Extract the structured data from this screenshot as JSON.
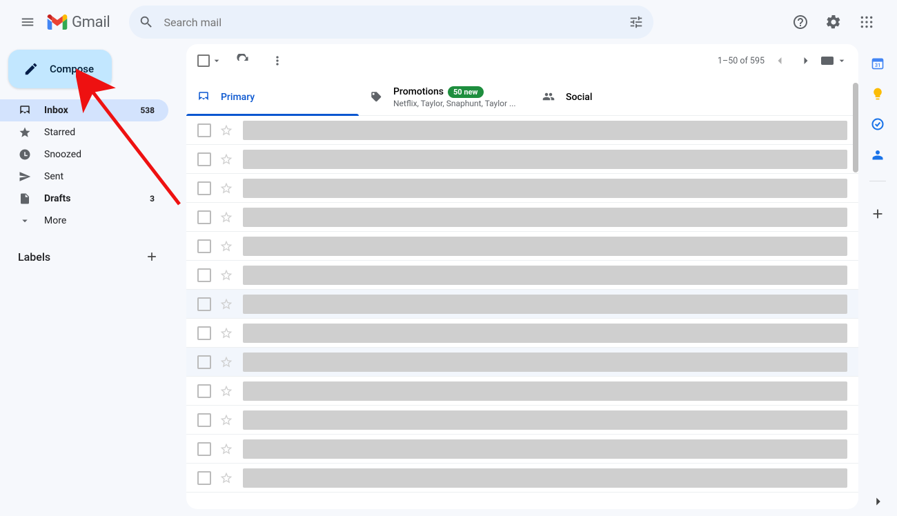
{
  "header": {
    "app_name": "Gmail",
    "search_placeholder": "Search mail"
  },
  "sidebar": {
    "compose_label": "Compose",
    "items": [
      {
        "label": "Inbox",
        "count": "538",
        "icon": "inbox",
        "bold": true,
        "active": true
      },
      {
        "label": "Starred",
        "count": "",
        "icon": "star",
        "bold": false,
        "active": false
      },
      {
        "label": "Snoozed",
        "count": "",
        "icon": "clock",
        "bold": false,
        "active": false
      },
      {
        "label": "Sent",
        "count": "",
        "icon": "send",
        "bold": false,
        "active": false
      },
      {
        "label": "Drafts",
        "count": "3",
        "icon": "file",
        "bold": true,
        "active": false
      },
      {
        "label": "More",
        "count": "",
        "icon": "chevdown",
        "bold": false,
        "active": false
      }
    ],
    "labels_heading": "Labels"
  },
  "toolbar": {
    "page_text": "1–50 of 595"
  },
  "tabs": [
    {
      "label": "Primary",
      "sub": "",
      "badge": "",
      "icon": "inbox",
      "active": true
    },
    {
      "label": "Promotions",
      "sub": "Netflix, Taylor, Snaphunt, Taylor ...",
      "badge": "50 new",
      "icon": "tag",
      "active": false
    },
    {
      "label": "Social",
      "sub": "",
      "badge": "",
      "icon": "people",
      "active": false
    }
  ],
  "mail_rows": [
    {
      "shaded": false
    },
    {
      "shaded": false
    },
    {
      "shaded": false
    },
    {
      "shaded": false
    },
    {
      "shaded": false
    },
    {
      "shaded": false
    },
    {
      "shaded": true
    },
    {
      "shaded": false
    },
    {
      "shaded": true
    },
    {
      "shaded": false
    },
    {
      "shaded": false
    },
    {
      "shaded": false
    },
    {
      "shaded": false
    }
  ],
  "rightpanel": {
    "icons": [
      "calendar",
      "keep",
      "tasks",
      "contacts"
    ]
  }
}
